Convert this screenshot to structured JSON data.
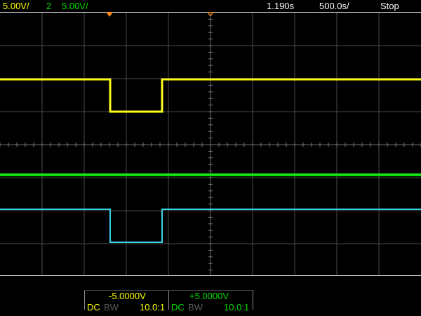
{
  "top_bar": {
    "ch1_scale": "5.00V/",
    "ch2_number": "2",
    "ch2_scale": "5.00V/",
    "time_position": "1.190s",
    "time_scale": "500.0s/",
    "run_state": "Stop"
  },
  "bottom_bar": {
    "ch1_offset": "-5.0000V",
    "ch2_offset": "+5.0000V",
    "ch1_coupling": "DC",
    "ch1_bw": "BW",
    "ch1_probe": "10.0:1",
    "ch2_coupling": "DC",
    "ch2_bw": "BW",
    "ch2_probe": "10.0:1"
  },
  "colors": {
    "ch1": "#ffff00",
    "ch2": "#00e000",
    "ch3": "#33d6e6",
    "trigger_marker": "#ff8c1a",
    "grid": "#5a5a5a"
  }
}
